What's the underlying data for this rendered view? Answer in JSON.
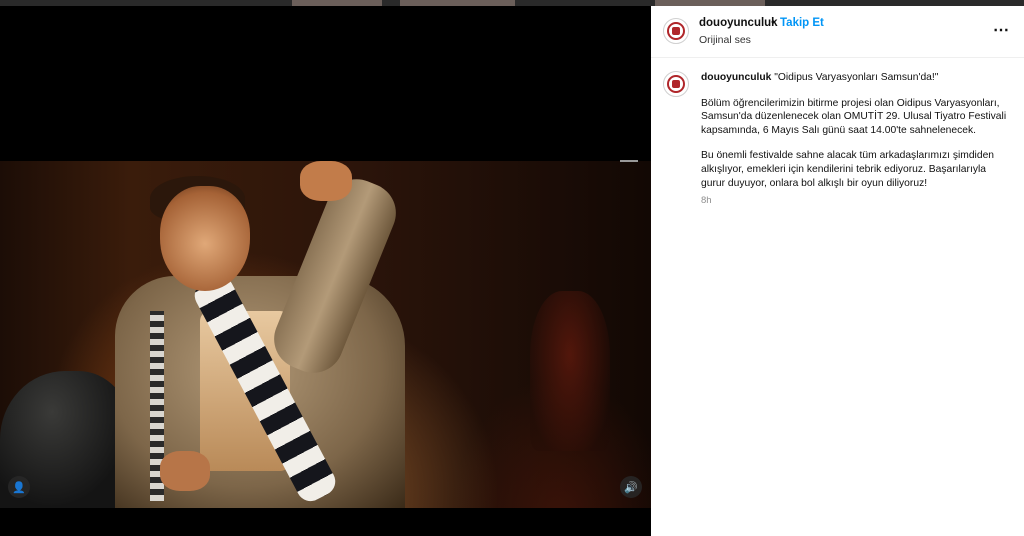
{
  "post": {
    "username": "douoyunculuk",
    "dot": "•",
    "follow_label": "Takip Et",
    "audio_label": "Orijinal ses",
    "more_icon": "⋯"
  },
  "caption": {
    "username": "douoyunculuk",
    "headline": "\"Oidipus Varyasyonları Samsun'da!\"",
    "paragraph1": "Bölüm öğrencilerimizin bitirme projesi olan Oidipus Varyasyonları, Samsun'da düzenlenecek olan OMUTİT 29. Ulusal Tiyatro Festivali kapsamında, 6 Mayıs Salı günü saat 14.00'te sahnelenecek.",
    "paragraph2": "Bu önemli festivalde sahne alacak tüm arkadaşlarımızı şimdiden alkışlıyor, emekleri için kendilerini tebrik ediyoruz. Başarılarıyla gurur duyuyor, onlara bol alkışlı bir oyun diliyoruz!",
    "time": "8h"
  },
  "video_controls": {
    "user_icon": "👤",
    "sound_icon": "🔊"
  },
  "colors": {
    "follow": "#0095f6",
    "logo": "#b0262a"
  }
}
